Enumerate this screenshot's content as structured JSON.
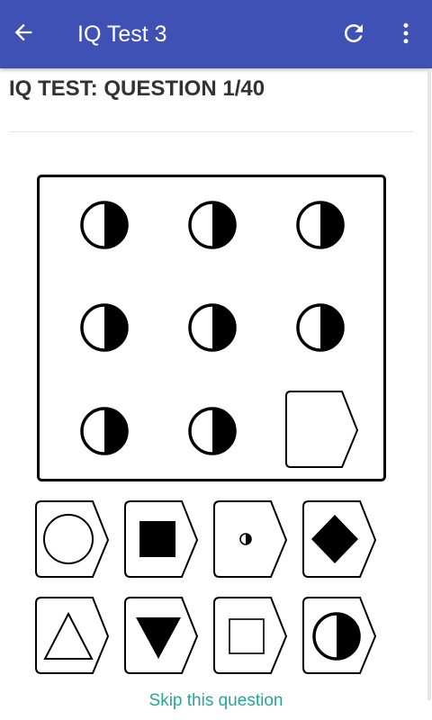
{
  "appbar": {
    "title": "IQ Test 3",
    "color": "#3f51b5",
    "icons": [
      "arrow-back-icon",
      "refresh-icon",
      "more-vert-icon"
    ]
  },
  "question": {
    "heading": "IQ TEST: QUESTION 1/40",
    "matrix": [
      [
        "half-moon",
        "half-moon",
        "half-moon"
      ],
      [
        "half-moon",
        "half-moon",
        "half-moon"
      ],
      [
        "half-moon",
        "half-moon",
        "empty-answer-slot"
      ]
    ]
  },
  "options": [
    {
      "shape": "circle-outline"
    },
    {
      "shape": "filled-square"
    },
    {
      "shape": "small-half-circle"
    },
    {
      "shape": "filled-diamond"
    },
    {
      "shape": "triangle-outline"
    },
    {
      "shape": "filled-inverted-triangle"
    },
    {
      "shape": "square-outline"
    },
    {
      "shape": "half-moon"
    }
  ],
  "skip_label": "Skip this question",
  "skip_color": "#26a69a"
}
